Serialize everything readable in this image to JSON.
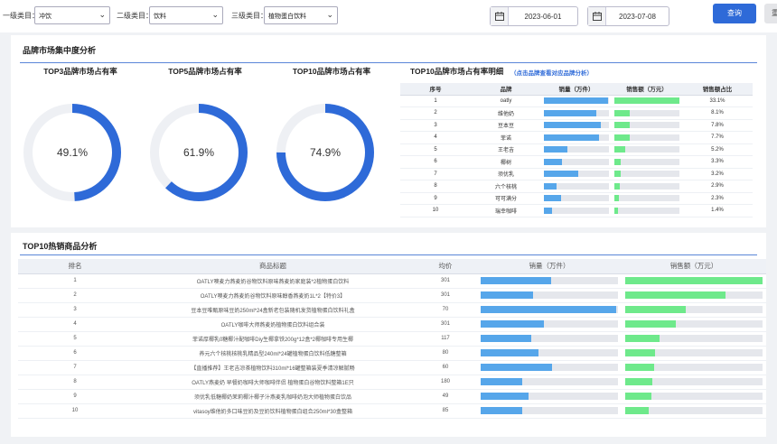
{
  "filters": {
    "level1_label": "一级类目：",
    "level1_value": "冲饮",
    "level2_label": "二级类目：",
    "level2_value": "饮料",
    "level3_label": "三级类目：",
    "level3_value": "植物蛋白饮料",
    "start_date": "2023-06-01",
    "end_date": "2023-07-08",
    "query_label": "查询",
    "reset_label": "重"
  },
  "concentration": {
    "title": "品牌市场集中度分析",
    "donuts": [
      {
        "title": "TOP3品牌市场占有率",
        "value_label": "49.1%",
        "value": 0.491
      },
      {
        "title": "TOP5品牌市场占有率",
        "value_label": "61.9%",
        "value": 0.619
      },
      {
        "title": "TOP10品牌市场占有率",
        "value_label": "74.9%",
        "value": 0.749
      }
    ],
    "donut_color": "#2e6ad8",
    "donut_track_color": "#eef0f4",
    "table_title": "TOP10品牌市场占有率明细",
    "table_link": "（点击品牌查看对应品牌分析）",
    "headers": [
      "序号",
      "品牌",
      "销量（万件）",
      "销售额（万元）",
      "销售额占比"
    ],
    "rows": [
      {
        "rank": "1",
        "brand": "oatly",
        "volume": 0.98,
        "sales": 1.0,
        "share": "33.1%"
      },
      {
        "rank": "2",
        "brand": "维他奶",
        "volume": 0.8,
        "sales": 0.24,
        "share": "8.1%"
      },
      {
        "rank": "3",
        "brand": "豆本豆",
        "volume": 0.88,
        "sales": 0.24,
        "share": "7.8%"
      },
      {
        "rank": "4",
        "brand": "菲诺",
        "volume": 0.85,
        "sales": 0.23,
        "share": "7.7%"
      },
      {
        "rank": "5",
        "brand": "王老吉",
        "volume": 0.36,
        "sales": 0.16,
        "share": "5.2%"
      },
      {
        "rank": "6",
        "brand": "椰树",
        "volume": 0.28,
        "sales": 0.1,
        "share": "3.3%"
      },
      {
        "rank": "7",
        "brand": "须优乳",
        "volume": 0.53,
        "sales": 0.1,
        "share": "3.2%"
      },
      {
        "rank": "8",
        "brand": "六个核桃",
        "volume": 0.2,
        "sales": 0.09,
        "share": "2.9%"
      },
      {
        "rank": "9",
        "brand": "可可满分",
        "volume": 0.26,
        "sales": 0.07,
        "share": "2.3%"
      },
      {
        "rank": "10",
        "brand": "瑞幸咖啡",
        "volume": 0.13,
        "sales": 0.05,
        "share": "1.4%"
      }
    ]
  },
  "hot_products": {
    "title": "TOP10热销商品分析",
    "headers": [
      "排名",
      "商品标题",
      "均价",
      "销量（万件）",
      "销售额（万元）"
    ],
    "rows": [
      {
        "rank": "1",
        "title": "OATLY噢麦力燕麦奶谷物饮料原味燕麦奶家庭装*2植物蛋白饮料",
        "price": "301",
        "volume": 0.51,
        "sales": 1.0
      },
      {
        "rank": "2",
        "title": "OATLY噢麦力燕麦奶谷物饮料原味醇香燕麦奶1L*2【特价3】",
        "price": "301",
        "volume": 0.38,
        "sales": 0.73
      },
      {
        "rank": "3",
        "title": "豆本豆唯甄原味豆奶250ml*24盒新老包装随机发货植物蛋白饮料礼盒",
        "price": "70",
        "volume": 0.99,
        "sales": 0.44
      },
      {
        "rank": "4",
        "title": "OATLY咖啡大师燕麦奶植物蛋白饮料组合装",
        "price": "301",
        "volume": 0.46,
        "sales": 0.37
      },
      {
        "rank": "5",
        "title": "菲诺厚椰乳0糖椰汁配咖啡Diy生椰拿铁200g*12盒*2椰咖啡专用生椰",
        "price": "117",
        "volume": 0.37,
        "sales": 0.25
      },
      {
        "rank": "6",
        "title": "养元六个核桃核桃乳精品型240ml*24罐植物蛋白饮料低糖整箱",
        "price": "80",
        "volume": 0.42,
        "sales": 0.22
      },
      {
        "rank": "7",
        "title": "【直播推荐】王老吉凉茶植物饮料310ml*16罐整箱装夏季清凉解腻畅",
        "price": "60",
        "volume": 0.52,
        "sales": 0.21
      },
      {
        "rank": "8",
        "title": "OATLY燕麦奶 早餐奶咖啡大师咖啡伴侣 植物蛋白谷物饮料整箱1E只",
        "price": "180",
        "volume": 0.3,
        "sales": 0.2
      },
      {
        "rank": "9",
        "title": "须优乳低糖椰奶茉莉椰汁椰子汁燕麦乳咖啡奶泡大师植物蛋白饮品",
        "price": "49",
        "volume": 0.35,
        "sales": 0.19
      },
      {
        "rank": "10",
        "title": "vitasoy维他奶多口味豆奶及豆奶饮料植物蛋白组合250ml*30盒整箱",
        "price": "85",
        "volume": 0.3,
        "sales": 0.17
      }
    ]
  }
}
